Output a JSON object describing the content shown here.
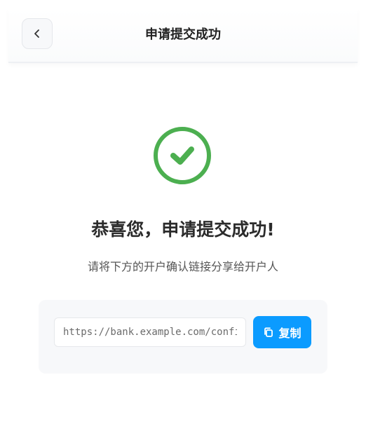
{
  "header": {
    "title": "申请提交成功"
  },
  "status": {
    "icon": "check-circle-icon",
    "color": "#4caf50"
  },
  "main": {
    "heading": "恭喜您，申请提交成功!",
    "subtext": "请将下方的开户确认链接分享给开户人"
  },
  "link": {
    "value": "https://bank.example.com/confi"
  },
  "copy_button": {
    "label": "复制",
    "icon": "copy-icon",
    "color": "#0b9bff"
  }
}
